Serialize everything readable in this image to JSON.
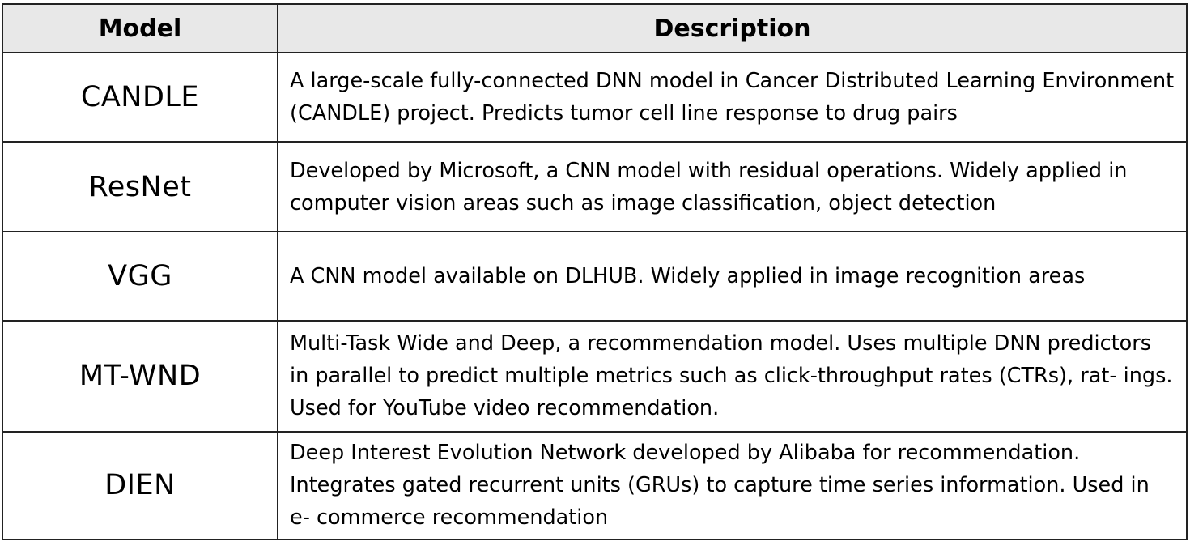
{
  "table": {
    "headers": [
      "Model",
      "Description"
    ],
    "rows": [
      {
        "model": "CANDLE",
        "description": "A large-scale fully-connected DNN model in Cancer Distributed Learning Environment (CANDLE) project. Predicts tumor cell line response to drug pairs"
      },
      {
        "model": "ResNet",
        "description": "Developed by Microsoft, a CNN model with residual operations. Widely applied in computer vision areas such as image classification, object detection"
      },
      {
        "model": "VGG",
        "description": "A CNN model available on DLHUB. Widely applied in image recognition areas"
      },
      {
        "model": "MT-WND",
        "description": "Multi-Task Wide and Deep, a recommendation model. Uses multiple DNN predictors in parallel to predict multiple metrics such as click-throughput rates (CTRs), rat- ings. Used for YouTube video recommendation."
      },
      {
        "model": "DIEN",
        "description": "Deep Interest Evolution Network developed by Alibaba for recommendation. Integrates gated recurrent units (GRUs) to capture time series information. Used in e- commerce recommendation"
      }
    ]
  }
}
